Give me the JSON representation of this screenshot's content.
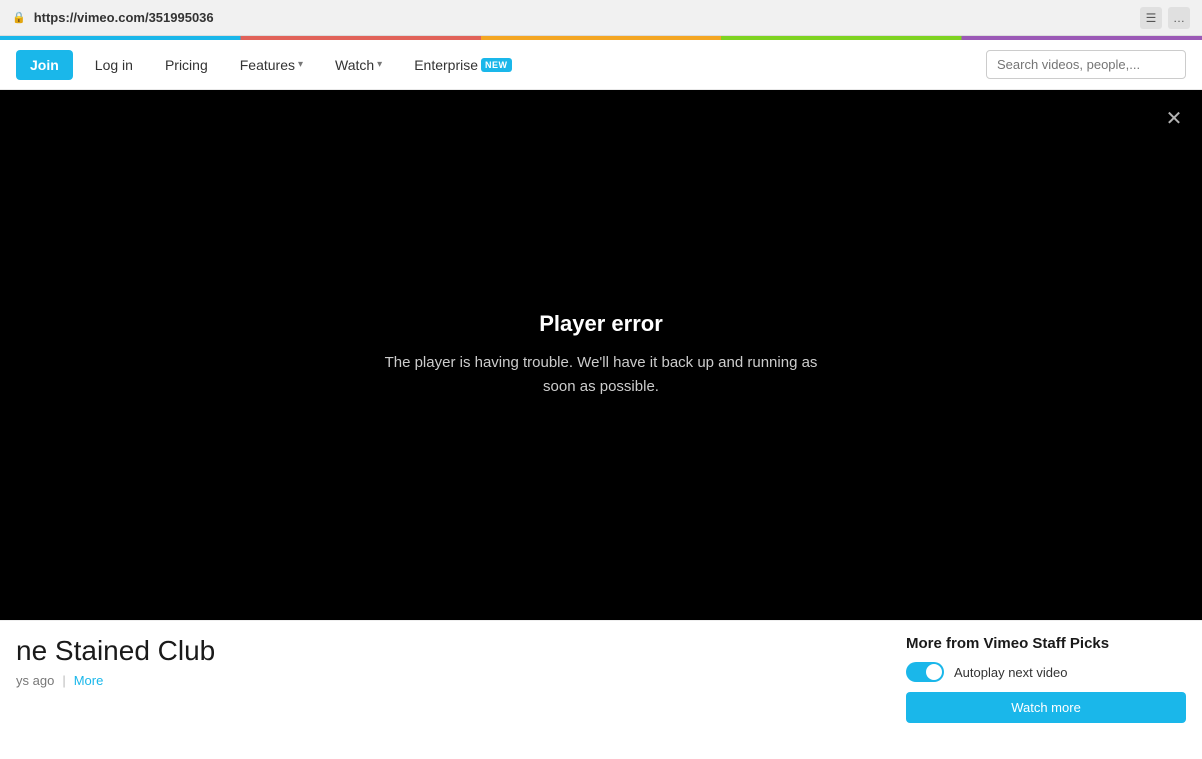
{
  "browser": {
    "url_prefix": "https://",
    "url_domain": "vimeo.com",
    "url_path": "/351995036",
    "lock_icon": "🔒",
    "btn1": "☰",
    "btn2": "…"
  },
  "nav": {
    "join_label": "Join",
    "login_label": "Log in",
    "pricing_label": "Pricing",
    "features_label": "Features",
    "watch_label": "Watch",
    "enterprise_label": "Enterprise",
    "new_badge": "NEW",
    "search_placeholder": "Search videos, people,..."
  },
  "player": {
    "error_title": "Player error",
    "error_message": "The player is having trouble. We'll have it back up and running as soon as possible.",
    "close_icon": "✕"
  },
  "video": {
    "title": "ne Stained Club",
    "time_ago": "ys ago",
    "more_label": "More"
  },
  "sidebar": {
    "title": "More from Vimeo Staff Picks",
    "autoplay_label": "Autoplay next video",
    "cta_label": "Watch more"
  }
}
